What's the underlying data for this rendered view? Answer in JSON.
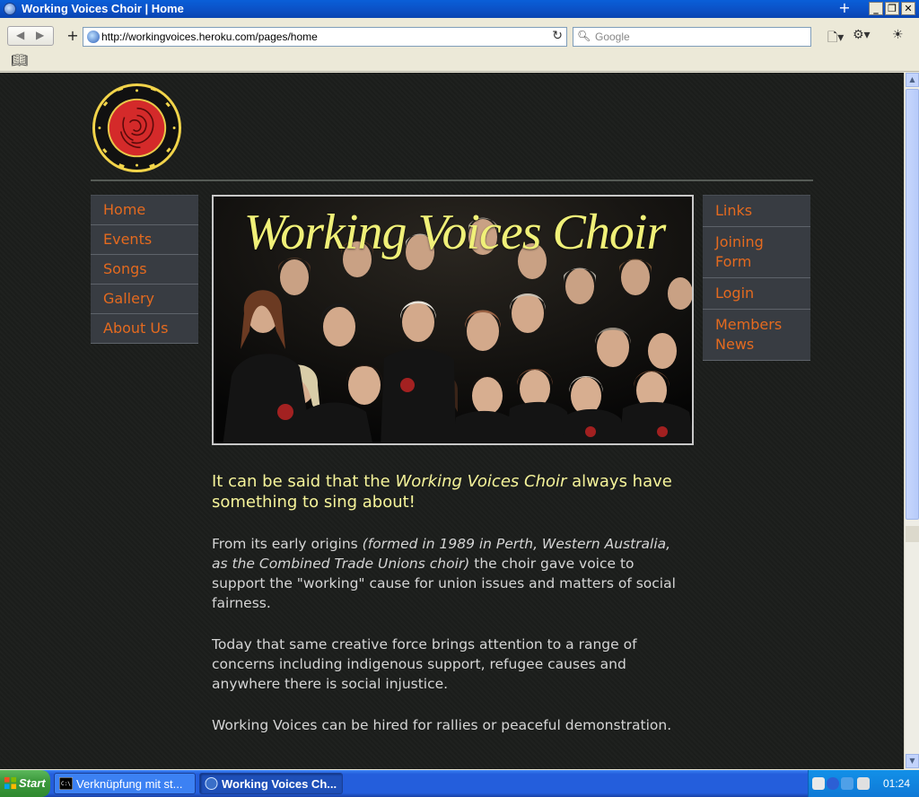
{
  "window": {
    "title": "Working Voices Choir | Home"
  },
  "toolbar": {
    "url": "http://workingvoices.heroku.com/pages/home",
    "search_placeholder": "Google"
  },
  "site": {
    "logo_icon": "rose-seal-logo",
    "hero_title": "Working Voices Choir",
    "nav_left": [
      "Home",
      "Events",
      "Songs",
      "Gallery",
      "About Us"
    ],
    "nav_right": [
      "Links",
      "Joining Form",
      "Login",
      "Members News"
    ]
  },
  "content": {
    "lead_part1": "It can be said that the ",
    "lead_em": "Working Voices Choir",
    "lead_part2": " always have something to sing about!",
    "p1_part1": "From its early origins ",
    "p1_em": "(formed in 1989 in Perth, Western Australia, as the Combined Trade Unions choir)",
    "p1_part2": " the choir gave voice to support the \"working\" cause for union issues and matters of social fairness.",
    "p2": "Today that same creative force brings attention to a range of concerns including indigenous support, refugee causes and anywhere there is social injustice.",
    "p3": "Working Voices can be hired for rallies or peaceful demonstration."
  },
  "taskbar": {
    "start_label": "Start",
    "tasks": [
      "Verknüpfung mit st...",
      "Working Voices Ch..."
    ],
    "clock": "01:24"
  },
  "colors": {
    "page_bg": "#1b1d1b",
    "nav_link": "#e46a1f",
    "lead_text": "#f6f49a",
    "hero_title": "#f0f078"
  }
}
